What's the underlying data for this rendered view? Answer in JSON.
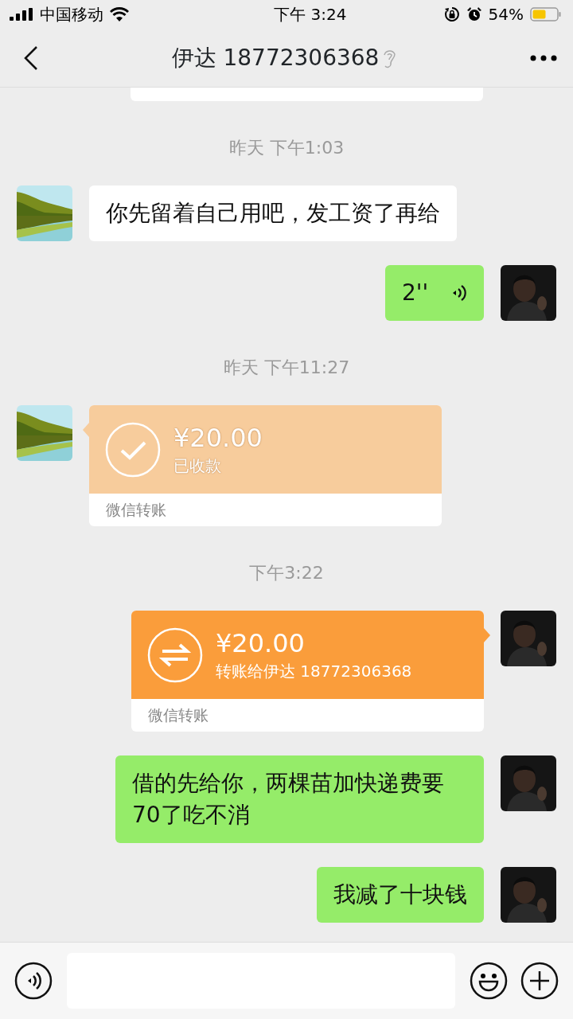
{
  "status_bar": {
    "carrier": "中国移动",
    "time": "下午 3:24",
    "battery": "54%"
  },
  "header": {
    "title": "伊达 18772306368"
  },
  "messages": [
    {
      "kind": "partial"
    },
    {
      "kind": "time",
      "text": "昨天 下午1:03"
    },
    {
      "kind": "text",
      "outgoing": false,
      "text": "你先留着自己用吧，发工资了再给"
    },
    {
      "kind": "voice",
      "outgoing": true,
      "duration": "2''"
    },
    {
      "kind": "time",
      "text": "昨天 下午11:27"
    },
    {
      "kind": "transfer",
      "outgoing": false,
      "accepted": true,
      "amount": "¥20.00",
      "note": "已收款",
      "footer": "微信转账"
    },
    {
      "kind": "time",
      "text": "下午3:22"
    },
    {
      "kind": "transfer",
      "outgoing": true,
      "accepted": false,
      "amount": "¥20.00",
      "note": "转账给伊达 18772306368",
      "footer": "微信转账"
    },
    {
      "kind": "text",
      "outgoing": true,
      "text": "借的先给你，两棵苗加快递费要70了吃不消"
    },
    {
      "kind": "text",
      "outgoing": true,
      "text": "我减了十块钱"
    }
  ]
}
